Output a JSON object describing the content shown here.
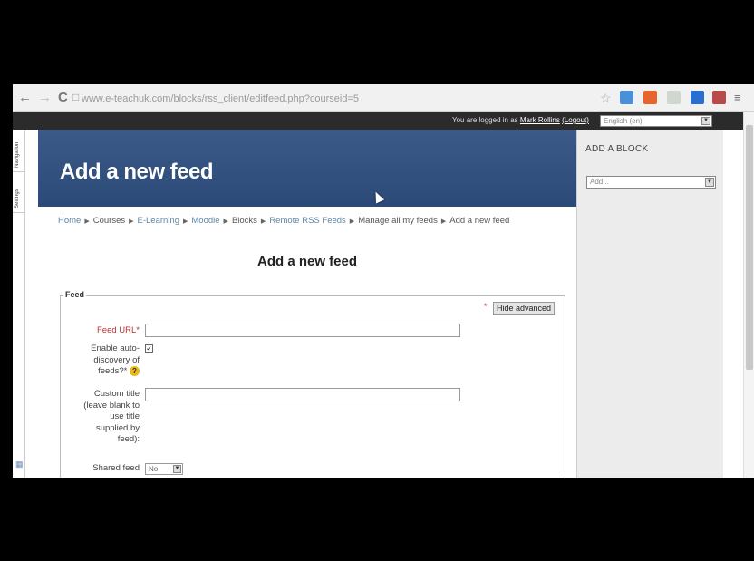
{
  "browser": {
    "url": "www.e-teachuk.com/blocks/rss_client/editfeed.php?courseid=5",
    "back_icon": "←",
    "forward_icon": "→",
    "reload_icon": "C"
  },
  "topbar": {
    "logged_in_prefix": "You are logged in as ",
    "user_name": "Mark Rollins",
    "logout": "(Logout)",
    "language": "English (en)"
  },
  "dock": {
    "tabs": [
      "Navigation",
      "Settings"
    ]
  },
  "header": {
    "title": "Add a new feed"
  },
  "breadcrumb": [
    "Home",
    "Courses",
    "E-Learning",
    "Moodle",
    "Blocks",
    "Remote RSS Feeds",
    "Manage all my feeds",
    "Add a new feed"
  ],
  "page_title": "Add a new feed",
  "form": {
    "legend": "Feed",
    "hide_advanced": "Hide advanced",
    "feed_url_label": "Feed URL*",
    "feed_url_value": "",
    "autodiscover_label_lines": [
      "Enable auto-",
      "discovery of",
      "feeds?*"
    ],
    "autodiscover_checked": true,
    "custom_title_label_lines": [
      "Custom title",
      "(leave blank to",
      "use title",
      "supplied by",
      "feed):"
    ],
    "custom_title_value": "",
    "shared_feed_label": "Shared feed",
    "shared_feed_value": "No"
  },
  "right_block": {
    "title": "ADD A BLOCK",
    "select_value": "Add..."
  },
  "colors": {
    "header_bg": "#3c5a87",
    "link": "#5a87a8",
    "required": "#b33333",
    "topbar_bg": "#2b2b2b"
  }
}
